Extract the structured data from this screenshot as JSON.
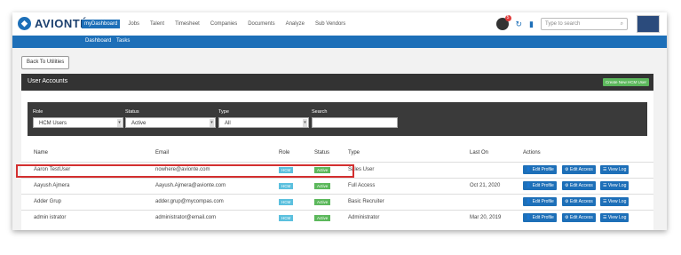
{
  "header": {
    "logo_text": "AVIONTÉ",
    "nav": [
      "myDashboard",
      "Jobs",
      "Talent",
      "Timesheet",
      "Companies",
      "Documents",
      "Analyze",
      "Sub Vendors"
    ],
    "notification_count": "5",
    "search_placeholder": "Type to search"
  },
  "subnav": [
    "Dashboard",
    "Tasks"
  ],
  "back_button": "Back To Utilities",
  "panel": {
    "title": "User Accounts",
    "create_button": "Create New HCM User"
  },
  "filters": {
    "role_label": "Role",
    "role_value": "HCM Users",
    "status_label": "Status",
    "status_value": "Active",
    "type_label": "Type",
    "type_value": "All",
    "search_label": "Search",
    "search_value": ""
  },
  "table": {
    "columns": [
      "Name",
      "Email",
      "Role",
      "Status",
      "Type",
      "Last On",
      "Actions"
    ],
    "rows": [
      {
        "name": "Aaron TestUser",
        "email": "nowhere@avionte.com",
        "role": "HCM",
        "status": "Active",
        "type": "Sales User",
        "last_on": ""
      },
      {
        "name": "Aayush Ajmera",
        "email": "Aayush.Ajmera@avionte.com",
        "role": "HCM",
        "status": "Active",
        "type": "Full Access",
        "last_on": "Oct 21, 2020"
      },
      {
        "name": "Adder Grup",
        "email": "adder.grup@mycompas.com",
        "role": "HCM",
        "status": "Active",
        "type": "Basic Recruiter",
        "last_on": ""
      },
      {
        "name": "admin istrator",
        "email": "administrator@email.com",
        "role": "HCM",
        "status": "Active",
        "type": "Administrator",
        "last_on": "Mar 20, 2019"
      }
    ],
    "action_labels": {
      "edit_profile": "Edit Profile",
      "edit_access": "Edit Access",
      "view_log": "View Log"
    }
  },
  "colors": {
    "brand": "#1d6fb8",
    "panel_dark": "#333333",
    "success": "#5cb85c",
    "info": "#5bc0de",
    "highlight": "#d32f2f"
  }
}
